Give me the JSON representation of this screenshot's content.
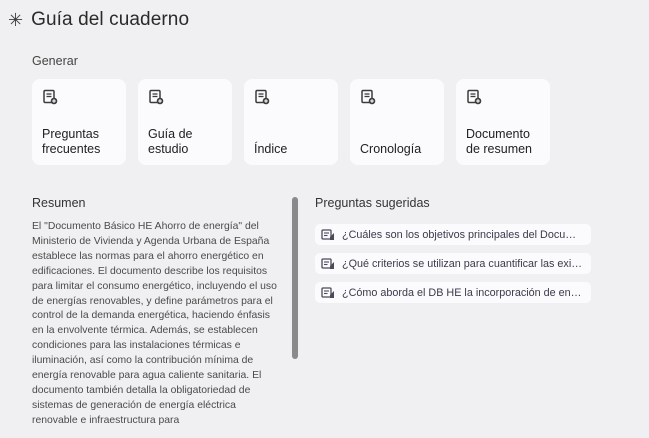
{
  "header": {
    "icon": "asterisk-spark-icon",
    "title": "Guía del cuaderno"
  },
  "generar": {
    "label": "Generar",
    "cards": [
      {
        "label": "Preguntas frecuentes",
        "icon": "note-add-icon"
      },
      {
        "label": "Guía de estudio",
        "icon": "note-add-icon"
      },
      {
        "label": "Índice",
        "icon": "note-add-icon"
      },
      {
        "label": "Cronología",
        "icon": "note-add-icon"
      },
      {
        "label": "Documento de resumen",
        "icon": "note-add-icon"
      }
    ]
  },
  "resumen": {
    "title": "Resumen",
    "text": "El \"Documento Básico HE Ahorro de energía\" del Ministerio de Vivienda y Agenda Urbana de España establece las normas para el ahorro energético en edificaciones. El documento describe los requisitos para limitar el consumo energético, incluyendo el uso de energías renovables, y define parámetros para el control de la demanda energética, haciendo énfasis en la envolvente térmica. Además, se establecen condiciones para las instalaciones térmicas e iluminación, así como la contribución mínima de energía renovable para agua caliente sanitaria. El documento también detalla la obligatoriedad de sistemas de generación de energía eléctrica renovable e infraestructura para"
  },
  "sugeridas": {
    "title": "Preguntas sugeridas",
    "items": [
      "¿Cuáles son los objetivos principales del Documento Básico HE?",
      "¿Qué criterios se utilizan para cuantificar las exigencias?",
      "¿Cómo aborda el DB HE la incorporación de energías renovables?"
    ]
  }
}
